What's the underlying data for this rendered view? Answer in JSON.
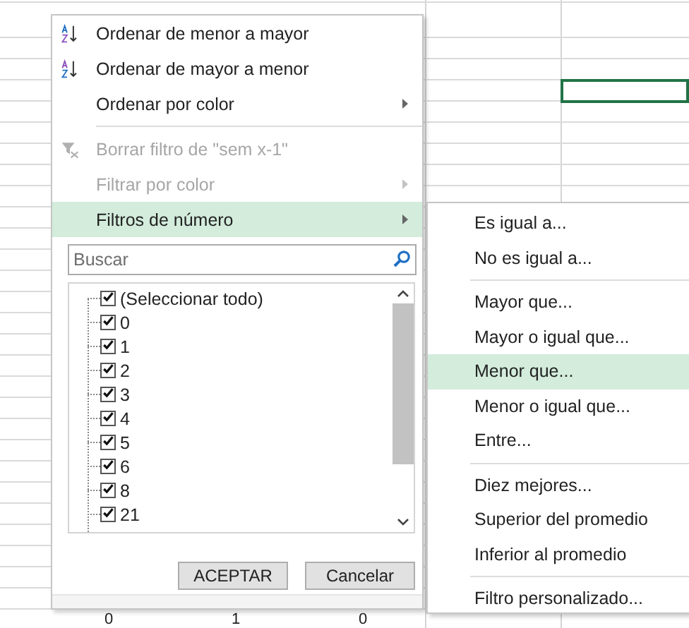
{
  "menu": {
    "items": [
      {
        "kind": "sort_ascending",
        "label": "Ordenar de menor a mayor",
        "disabled": false,
        "selected": false,
        "has_submenu": false
      },
      {
        "kind": "sort_descending",
        "label": "Ordenar de mayor a menor",
        "disabled": false,
        "selected": false,
        "has_submenu": false
      },
      {
        "kind": "item",
        "label": "Ordenar por color",
        "disabled": false,
        "selected": false,
        "has_submenu": true
      },
      {
        "kind": "separator"
      },
      {
        "kind": "clear_filter",
        "label": "Borrar filtro de \"sem x-1\"",
        "disabled": true,
        "selected": false,
        "has_submenu": false
      },
      {
        "kind": "item",
        "label": "Filtrar por color",
        "disabled": true,
        "selected": false,
        "has_submenu": true
      },
      {
        "kind": "item",
        "label": "Filtros de número",
        "disabled": false,
        "selected": true,
        "has_submenu": true
      }
    ],
    "search": {
      "placeholder": "Buscar"
    },
    "values": [
      {
        "label": "(Seleccionar todo)",
        "checked": true
      },
      {
        "label": "0",
        "checked": true
      },
      {
        "label": "1",
        "checked": true
      },
      {
        "label": "2",
        "checked": true
      },
      {
        "label": "3",
        "checked": true
      },
      {
        "label": "4",
        "checked": true
      },
      {
        "label": "5",
        "checked": true
      },
      {
        "label": "6",
        "checked": true
      },
      {
        "label": "8",
        "checked": true
      },
      {
        "label": "21",
        "checked": true
      }
    ],
    "buttons": [
      "ACEPTAR",
      "Cancelar"
    ]
  },
  "submenu": {
    "items": [
      {
        "kind": "item",
        "label": "Es igual a...",
        "selected": false
      },
      {
        "kind": "item",
        "label": "No es igual a...",
        "selected": false
      },
      {
        "kind": "separator"
      },
      {
        "kind": "item",
        "label": "Mayor que...",
        "selected": false
      },
      {
        "kind": "item",
        "label": "Mayor o igual que...",
        "selected": false
      },
      {
        "kind": "item",
        "label": "Menor que...",
        "selected": true
      },
      {
        "kind": "item",
        "label": "Menor o igual que...",
        "selected": false
      },
      {
        "kind": "item",
        "label": "Entre...",
        "selected": false
      },
      {
        "kind": "separator"
      },
      {
        "kind": "item",
        "label": "Diez mejores...",
        "selected": false
      },
      {
        "kind": "item",
        "label": "Superior del promedio",
        "selected": false
      },
      {
        "kind": "item",
        "label": "Inferior al promedio",
        "selected": false
      },
      {
        "kind": "separator"
      },
      {
        "kind": "item",
        "label": "Filtro personalizado...",
        "selected": false
      }
    ]
  },
  "sheet": {
    "bottom_cells": [
      "0",
      "1",
      "0"
    ]
  }
}
